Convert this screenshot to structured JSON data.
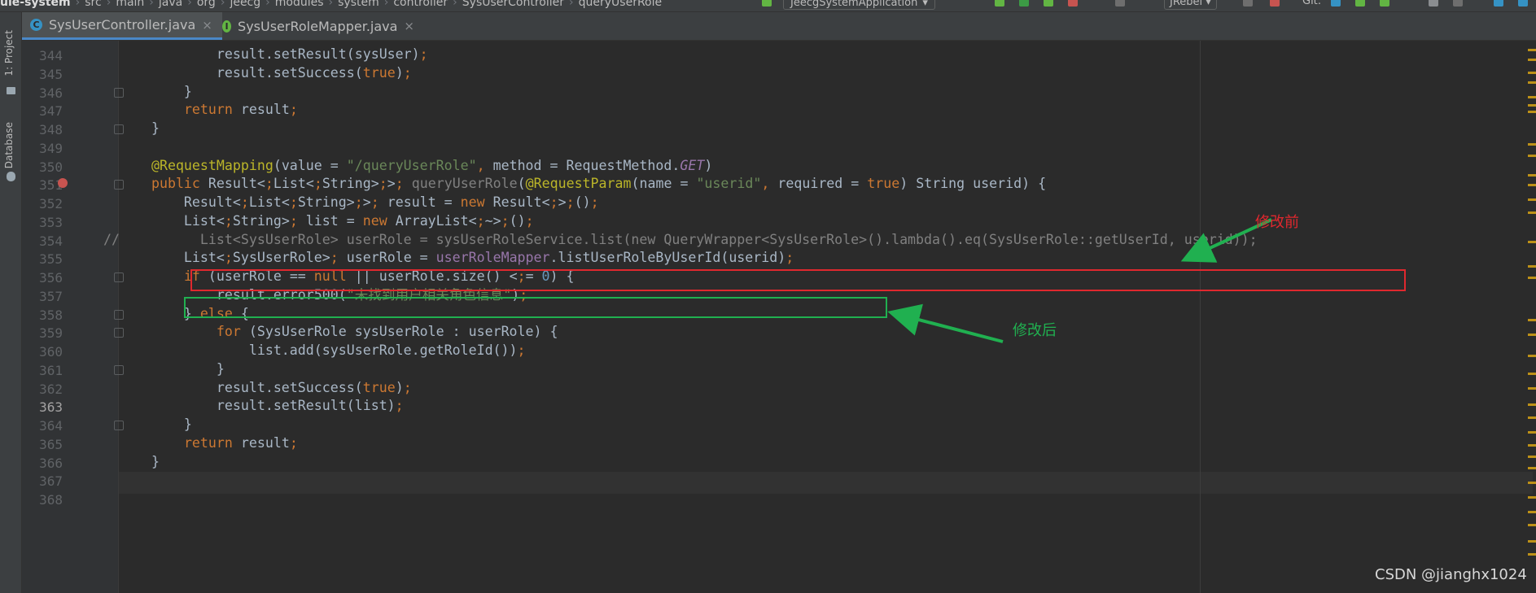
{
  "breadcrumbs": {
    "items": [
      "ule-system",
      "src",
      "main",
      "java",
      "org",
      "jeecg",
      "modules",
      "system",
      "controller",
      "SysUserController",
      "queryUserRole"
    ]
  },
  "toolbar": {
    "run_config": "JeecgSystemApplication",
    "jrebel": "JRebel",
    "git_label": "Git:"
  },
  "tool_windows": {
    "project": "1: Project",
    "database": "Database"
  },
  "tabs": [
    {
      "label": "SysUserController.java",
      "icon_letter": "C",
      "icon_color": "#3592c4",
      "active": true
    },
    {
      "label": "SysUserRoleMapper.java",
      "icon_letter": "I",
      "icon_color": "#62b543",
      "active": false
    }
  ],
  "editor": {
    "current_line": "363",
    "lines": [
      {
        "num": "344",
        "gutter_text": "",
        "code": "            result.setResult(sysUser);"
      },
      {
        "num": "345",
        "gutter_text": "",
        "code": "            result.setSuccess(true);"
      },
      {
        "num": "346",
        "gutter_text": "",
        "code": "        }"
      },
      {
        "num": "347",
        "gutter_text": "",
        "code": "        return result;"
      },
      {
        "num": "348",
        "gutter_text": "",
        "code": "    }"
      },
      {
        "num": "349",
        "gutter_text": "",
        "code": ""
      },
      {
        "num": "350",
        "gutter_text": "",
        "code": "    @RequestMapping(value = \"/queryUserRole\", method = RequestMethod.GET)"
      },
      {
        "num": "351",
        "gutter_text": "",
        "code": "    public Result<List<String>> queryUserRole(@RequestParam(name = \"userid\", required = true) String userid) {"
      },
      {
        "num": "352",
        "gutter_text": "",
        "code": "        Result<List<String>> result = new Result<>();"
      },
      {
        "num": "353",
        "gutter_text": "",
        "code": "        List<String> list = new ArrayList<~>();"
      },
      {
        "num": "354",
        "gutter_text": "//",
        "code": "          List<SysUserRole> userRole = sysUserRoleService.list(new QueryWrapper<SysUserRole>().lambda().eq(SysUserRole::getUserId, userid));"
      },
      {
        "num": "355",
        "gutter_text": "",
        "code": "        List<SysUserRole> userRole = userRoleMapper.listUserRoleByUserId(userid);"
      },
      {
        "num": "356",
        "gutter_text": "",
        "code": "        if (userRole == null || userRole.size() <= 0) {"
      },
      {
        "num": "357",
        "gutter_text": "",
        "code": "            result.error500(\"未找到用户相关角色信息\");"
      },
      {
        "num": "358",
        "gutter_text": "",
        "code": "        } else {"
      },
      {
        "num": "359",
        "gutter_text": "",
        "code": "            for (SysUserRole sysUserRole : userRole) {"
      },
      {
        "num": "360",
        "gutter_text": "",
        "code": "                list.add(sysUserRole.getRoleId());"
      },
      {
        "num": "361",
        "gutter_text": "",
        "code": "            }"
      },
      {
        "num": "362",
        "gutter_text": "",
        "code": "            result.setSuccess(true);"
      },
      {
        "num": "363",
        "gutter_text": "",
        "code": "            result.setResult(list);"
      },
      {
        "num": "364",
        "gutter_text": "",
        "code": "        }"
      },
      {
        "num": "365",
        "gutter_text": "",
        "code": "        return result;"
      },
      {
        "num": "366",
        "gutter_text": "",
        "code": "    }"
      },
      {
        "num": "367",
        "gutter_text": "",
        "code": ""
      },
      {
        "num": "368",
        "gutter_text": "",
        "code": ""
      }
    ]
  },
  "annotations": {
    "before_label": "修改前",
    "after_label": "修改后",
    "before_color": "#e0282e",
    "after_color": "#20b050"
  },
  "watermark": "CSDN @jianghx1024"
}
